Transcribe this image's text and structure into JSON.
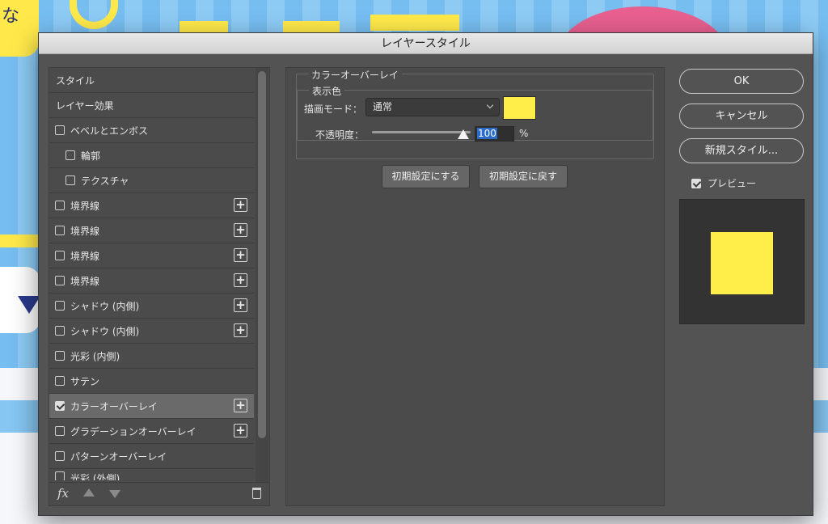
{
  "background": {
    "bubble_text": "な"
  },
  "dialog": {
    "title": "レイヤースタイル",
    "style_list": {
      "items": [
        {
          "label": "スタイル",
          "type": "heading"
        },
        {
          "label": "レイヤー効果",
          "type": "heading"
        },
        {
          "label": "ベベルとエンボス",
          "checked": false,
          "add": false
        },
        {
          "label": "輪郭",
          "checked": false,
          "add": false,
          "indent": true
        },
        {
          "label": "テクスチャ",
          "checked": false,
          "add": false,
          "indent": true
        },
        {
          "label": "境界線",
          "checked": false,
          "add": true
        },
        {
          "label": "境界線",
          "checked": false,
          "add": true
        },
        {
          "label": "境界線",
          "checked": false,
          "add": true
        },
        {
          "label": "境界線",
          "checked": false,
          "add": true
        },
        {
          "label": "シャドウ (内側)",
          "checked": false,
          "add": true
        },
        {
          "label": "シャドウ (内側)",
          "checked": false,
          "add": true
        },
        {
          "label": "光彩 (内側)",
          "checked": false,
          "add": false
        },
        {
          "label": "サテン",
          "checked": false,
          "add": false
        },
        {
          "label": "カラーオーバーレイ",
          "checked": true,
          "add": true,
          "selected": true
        },
        {
          "label": "グラデーションオーバーレイ",
          "checked": false,
          "add": true
        },
        {
          "label": "パターンオーバーレイ",
          "checked": false,
          "add": false
        },
        {
          "label": "光彩 (外側)",
          "checked": false,
          "add": false,
          "cut": true
        }
      ],
      "footer": {
        "fx_label": "fx"
      }
    },
    "color_overlay": {
      "section_title": "カラーオーバーレイ",
      "group_title": "表示色",
      "blend_mode_label": "描画モード：",
      "blend_mode_value": "通常",
      "swatch_color": "#ffee4a",
      "opacity_label": "不透明度：",
      "opacity_value": "100",
      "opacity_unit": "%",
      "btn_make_default": "初期設定にする",
      "btn_reset_default": "初期設定に戻す"
    },
    "buttons": {
      "ok": "OK",
      "cancel": "キャンセル",
      "new_style": "新規スタイル..."
    },
    "preview": {
      "label": "プレビュー",
      "checked": true,
      "swatch_color": "#ffee4a"
    }
  }
}
